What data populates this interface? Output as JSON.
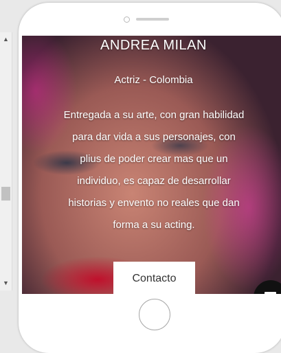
{
  "profile": {
    "name": "ANDREA MILAN",
    "role": "Actriz - Colombia",
    "bio": "Entregada a su arte, con gran habilidad para dar vida a sus personajes, con plius de poder crear mas que un individuo, es capaz de desarrollar historias y envento no reales que dan forma a su acting."
  },
  "contact": {
    "label": "Contacto"
  },
  "icons": {
    "chat": "chat-icon",
    "scroll_up": "▲",
    "scroll_down": "▼"
  },
  "colors": {
    "phone_frame": "#ffffff",
    "chat_button": "#111111",
    "text": "#ffffff"
  }
}
